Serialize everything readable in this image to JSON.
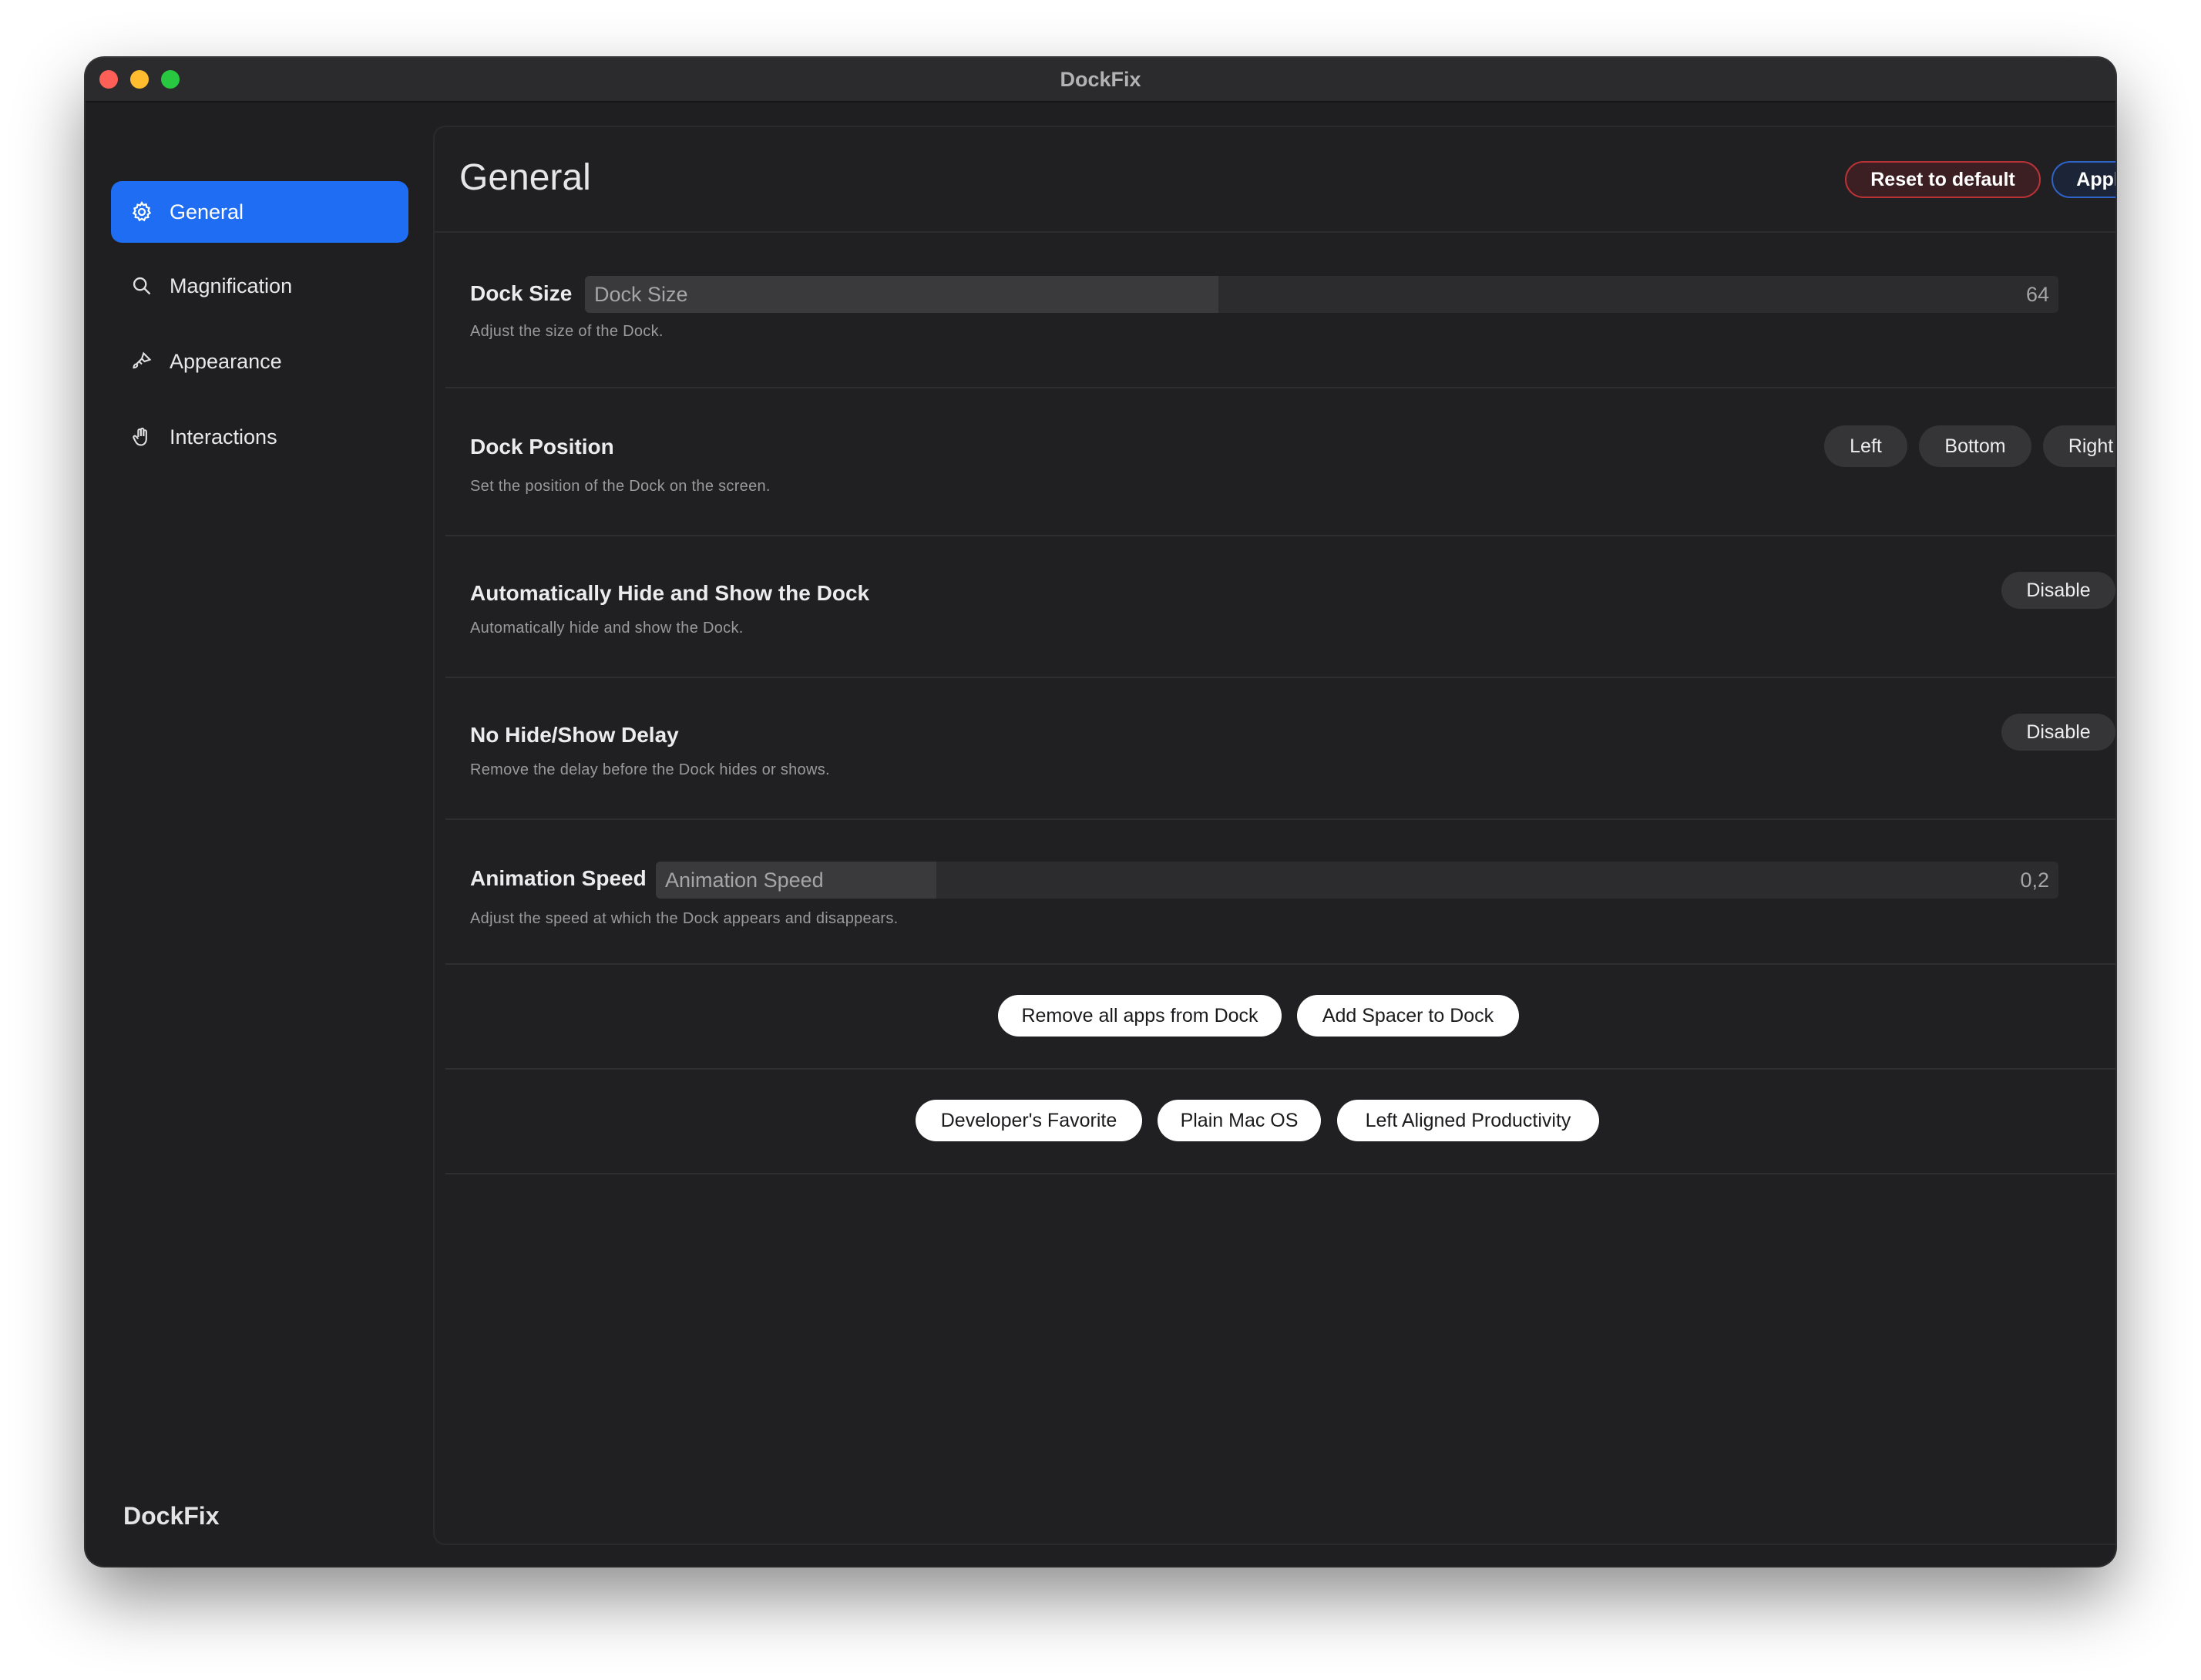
{
  "window": {
    "title": "DockFix",
    "traffic_lights": {
      "close_color": "#fe5f57",
      "minimize_color": "#febc2e",
      "zoom_color": "#28c840"
    }
  },
  "sidebar": {
    "items": [
      {
        "label": "General",
        "icon": "gear-icon",
        "active": true
      },
      {
        "label": "Magnification",
        "icon": "magnifier-icon",
        "active": false
      },
      {
        "label": "Appearance",
        "icon": "paintbrush-icon",
        "active": false
      },
      {
        "label": "Interactions",
        "icon": "hand-icon",
        "active": false
      }
    ],
    "footer": "DockFix",
    "accent_color": "#1f6df2"
  },
  "header": {
    "title": "General",
    "reset_label": "Reset to default",
    "apply_label": "Apply"
  },
  "settings": {
    "dock_size": {
      "label": "Dock Size",
      "slider_name": "Dock Size",
      "value": "64",
      "fill_fraction": 0.43,
      "description": "Adjust the size of the Dock."
    },
    "dock_position": {
      "label": "Dock Position",
      "description": "Set the position of the Dock on the screen.",
      "options": [
        "Left",
        "Bottom",
        "Right"
      ]
    },
    "auto_hide": {
      "label": "Automatically Hide and Show the Dock",
      "description": "Automatically hide and show the Dock.",
      "button": "Disable"
    },
    "no_delay": {
      "label": "No Hide/Show Delay",
      "description": "Remove the delay before the Dock hides or shows.",
      "button": "Disable"
    },
    "animation_speed": {
      "label": "Animation Speed",
      "slider_name": "Animation Speed",
      "value": "0,2",
      "fill_fraction": 0.2,
      "description": "Adjust the speed at which the Dock appears and disappears."
    }
  },
  "actions": {
    "remove_all": "Remove all apps from Dock",
    "add_spacer": "Add Spacer to Dock"
  },
  "presets": [
    "Developer's Favorite",
    "Plain Mac OS",
    "Left Aligned Productivity"
  ]
}
